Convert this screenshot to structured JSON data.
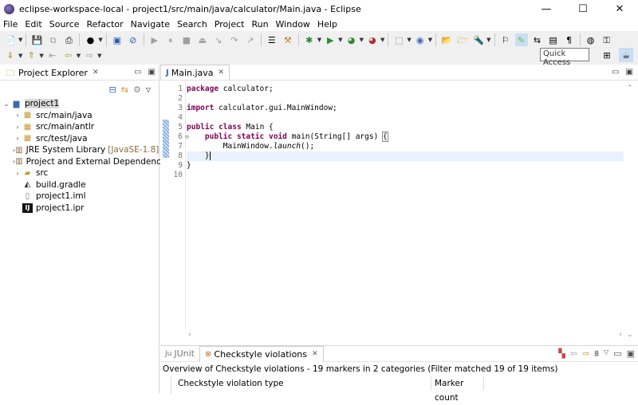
{
  "window": {
    "title": "eclipse-workspace-local - project1/src/main/java/calculator/Main.java - Eclipse",
    "minimize": "—",
    "maximize": "☐",
    "close": "✕"
  },
  "menu": [
    "File",
    "Edit",
    "Source",
    "Refactor",
    "Navigate",
    "Search",
    "Project",
    "Run",
    "Window",
    "Help"
  ],
  "toolbar": {
    "quick_access_placeholder": "Quick Access"
  },
  "project_explorer": {
    "tab_label": "Project Explorer",
    "tree": [
      {
        "label": "project1",
        "level": 0,
        "icon": "project-icon",
        "expanded": true,
        "selected": true,
        "decoration": ""
      },
      {
        "label": "src/main/java",
        "level": 1,
        "icon": "source-folder-icon",
        "decoration": ""
      },
      {
        "label": "src/main/antlr",
        "level": 1,
        "icon": "source-folder-icon",
        "decoration": ""
      },
      {
        "label": "src/test/java",
        "level": 1,
        "icon": "source-folder-icon",
        "decoration": ""
      },
      {
        "label": "JRE System Library",
        "level": 1,
        "icon": "library-icon",
        "decoration": "[JavaSE-1.8]"
      },
      {
        "label": "Project and External Dependencies",
        "level": 1,
        "icon": "library-icon",
        "decoration": ""
      },
      {
        "label": "src",
        "level": 1,
        "icon": "folder-icon",
        "decoration": ""
      },
      {
        "label": "build.gradle",
        "level": 1,
        "icon": "gradle-file-icon",
        "decoration": ""
      },
      {
        "label": "project1.iml",
        "level": 1,
        "icon": "file-icon",
        "decoration": ""
      },
      {
        "label": "project1.ipr",
        "level": 1,
        "icon": "intellij-file-icon",
        "decoration": ""
      }
    ]
  },
  "editor": {
    "tab_label": "Main.java",
    "line_numbers": [
      "1",
      "2",
      "3",
      "4",
      "5",
      "6",
      "7",
      "8",
      "9",
      "10"
    ],
    "lines": [
      "package calculator;",
      "",
      "import calculator.gui.MainWindow;",
      "",
      "public class Main {",
      "    public static void main(String[] args) {",
      "        MainWindow.launch();",
      "    }",
      "}",
      ""
    ]
  },
  "bottom_panel": {
    "tabs": [
      "JUnit",
      "Checkstyle violations"
    ],
    "overview": "Overview of Checkstyle violations - 19 markers in 2 categories (Filter matched 19 of 19 items)",
    "columns": [
      "Checkstyle violation type",
      "Marker count"
    ]
  }
}
